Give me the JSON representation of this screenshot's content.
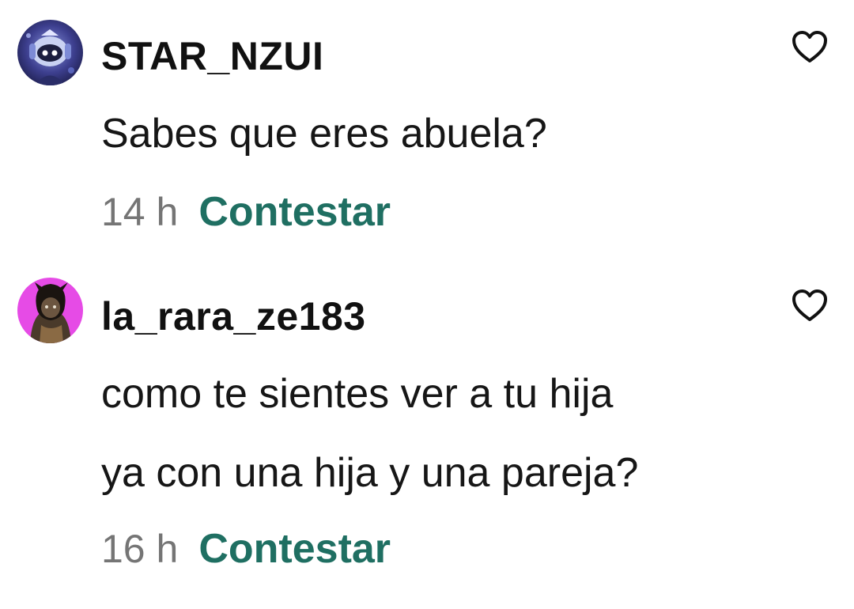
{
  "comments": [
    {
      "username": "STAR_NZUI",
      "text_lines": [
        "Sabes que eres abuela?"
      ],
      "time": "14 h",
      "reply_label": "Contestar",
      "avatar_icon": "robot-avatar-icon",
      "like_icon": "heart-outline-icon"
    },
    {
      "username": "la_rara_ze183",
      "text_lines": [
        "como te sientes ver a tu hija",
        "ya con una hija y una pareja?"
      ],
      "time": "16 h",
      "reply_label": "Contestar",
      "avatar_icon": "character-avatar-icon",
      "like_icon": "heart-outline-icon"
    }
  ],
  "colors": {
    "reply": "#1f6f62",
    "time": "#757575",
    "text": "#111111",
    "avatar2_bg": "#e64be6"
  }
}
